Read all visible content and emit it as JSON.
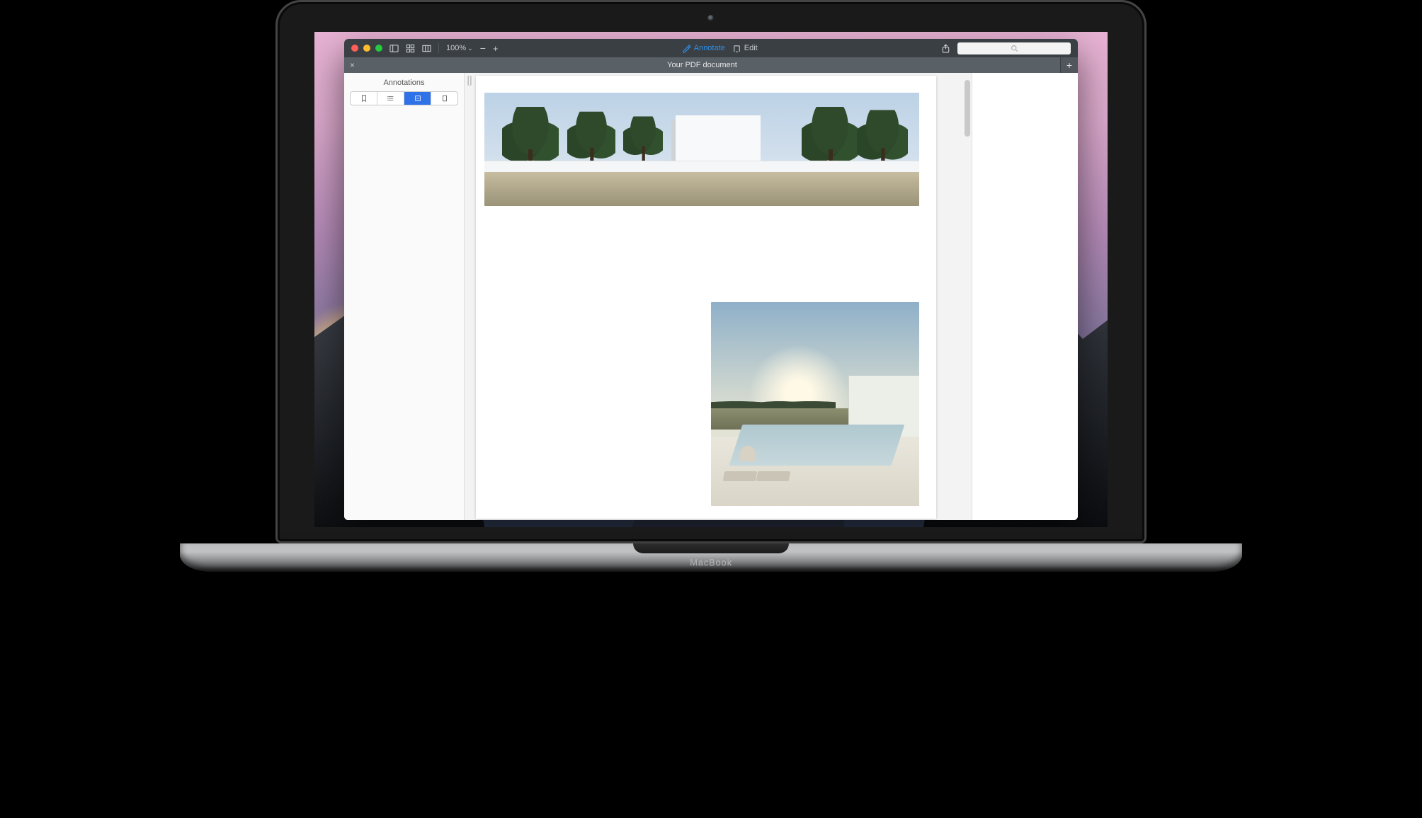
{
  "device_label": "MacBook",
  "toolbar": {
    "zoom": "100%",
    "annotate_label": "Annotate",
    "edit_label": "Edit"
  },
  "tabbar": {
    "tab_title": "Your PDF document"
  },
  "sidebar": {
    "title": "Annotations"
  },
  "search": {
    "placeholder": ""
  }
}
